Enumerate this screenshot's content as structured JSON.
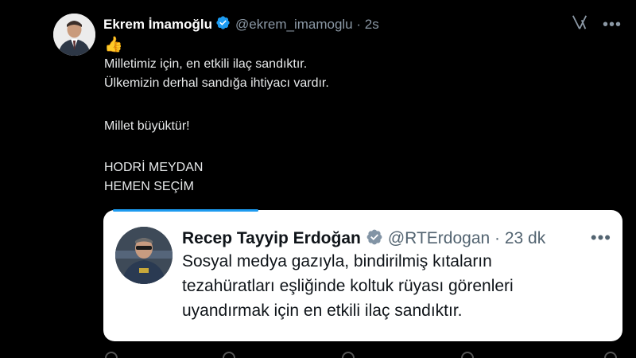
{
  "tweet": {
    "author_name": "Ekrem İmamoğlu",
    "author_handle": "@ekrem_imamoglu",
    "time": "2s",
    "emoji": "👍",
    "lines": [
      "Milletimiz için, en etkili ilaç sandıktır.",
      "Ülkemizin derhal sandığa ihtiyacı vardır.",
      "Millet büyüktür!",
      "HODRİ MEYDAN",
      "HEMEN SEÇİM"
    ]
  },
  "quote": {
    "author_name": "Recep Tayyip Erdoğan",
    "author_handle": "@RTErdogan",
    "time": "23 dk",
    "lines": [
      "Sosyal medya gazıyla, bindirilmiş kıtaların",
      "tezahüratları eşliğinde koltuk rüyası görenleri",
      "uyandırmak için en etkili ilaç sandıktır."
    ]
  },
  "colors": {
    "verified_badge": "#1d9bf0",
    "background": "#000000",
    "quote_background": "#ffffff"
  },
  "icons": {
    "verified": "verified-badge-icon",
    "grok": "grok-icon",
    "more": "more-icon"
  }
}
